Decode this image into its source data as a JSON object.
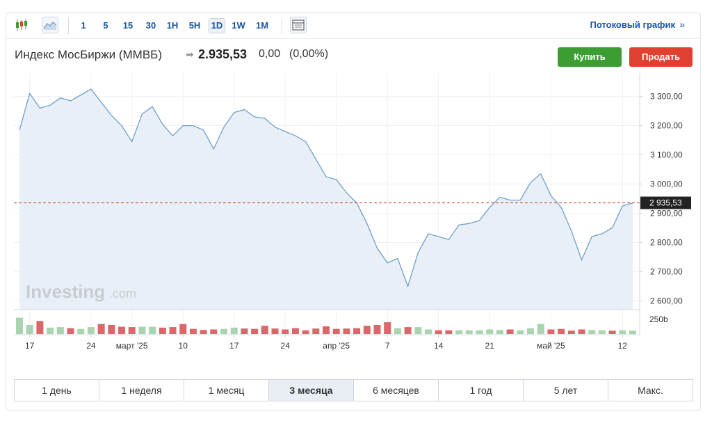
{
  "toolbar": {
    "candles_icon": "candlestick-icon",
    "area_icon": "area-chart-icon",
    "intervals": [
      "1",
      "5",
      "15",
      "30",
      "1H",
      "5H",
      "1D",
      "1W",
      "1M"
    ],
    "active_interval": "1D",
    "table_icon": "table-icon",
    "stream_label": "Потоковый график",
    "stream_arrow": "»"
  },
  "header": {
    "title": "Индекс МосБиржи (ММВБ)",
    "arrow": "➡",
    "price": "2.935,53",
    "change": "0,00",
    "change_pct": "(0,00%)",
    "buy_label": "Купить",
    "sell_label": "Продать"
  },
  "colors": {
    "line": "#6f9fc9",
    "fill": "#e9eff6",
    "vol_up": "#a9d4ad",
    "vol_down": "#d9686a",
    "last_price_line": "#c0392b",
    "accent": "#1a56a3"
  },
  "chart_data": {
    "type": "area",
    "y_ticks": [
      "3 300,00",
      "3 200,00",
      "3 100,00",
      "3 000,00",
      "2 900,00",
      "2 800,00",
      "2 700,00",
      "2 600,00"
    ],
    "y_tick_values": [
      3300,
      3200,
      3100,
      3000,
      2900,
      2800,
      2700,
      2600
    ],
    "ylim": [
      2570,
      3380
    ],
    "last_price_label": "2 935,53",
    "last_price": 2935.53,
    "volume_label": "250b",
    "x_ticks": [
      {
        "i": 1,
        "label": "17"
      },
      {
        "i": 7,
        "label": "24"
      },
      {
        "i": 11,
        "label": "март '25"
      },
      {
        "i": 16,
        "label": "10"
      },
      {
        "i": 21,
        "label": "17"
      },
      {
        "i": 26,
        "label": "24"
      },
      {
        "i": 31,
        "label": "апр '25"
      },
      {
        "i": 36,
        "label": "7"
      },
      {
        "i": 41,
        "label": "14"
      },
      {
        "i": 46,
        "label": "21"
      },
      {
        "i": 52,
        "label": "май '25"
      },
      {
        "i": 59,
        "label": "12"
      }
    ],
    "values": [
      3185,
      3310,
      3260,
      3270,
      3295,
      3285,
      3305,
      3325,
      3280,
      3235,
      3200,
      3145,
      3240,
      3265,
      3205,
      3165,
      3200,
      3200,
      3185,
      3120,
      3195,
      3245,
      3255,
      3230,
      3225,
      3195,
      3180,
      3165,
      3145,
      3085,
      3025,
      3015,
      2970,
      2935,
      2865,
      2780,
      2730,
      2745,
      2650,
      2765,
      2830,
      2820,
      2810,
      2860,
      2865,
      2875,
      2920,
      2955,
      2945,
      2945,
      3005,
      3035,
      2960,
      2920,
      2840,
      2740,
      2820,
      2830,
      2850,
      2925,
      2935
    ],
    "volume": [
      0.9,
      0.5,
      0.72,
      0.35,
      0.38,
      0.32,
      0.28,
      0.38,
      0.55,
      0.5,
      0.4,
      0.38,
      0.4,
      0.4,
      0.35,
      0.38,
      0.55,
      0.28,
      0.22,
      0.25,
      0.28,
      0.35,
      0.3,
      0.28,
      0.45,
      0.3,
      0.25,
      0.32,
      0.2,
      0.3,
      0.42,
      0.28,
      0.3,
      0.32,
      0.45,
      0.5,
      0.65,
      0.32,
      0.38,
      0.38,
      0.25,
      0.2,
      0.2,
      0.2,
      0.2,
      0.2,
      0.25,
      0.22,
      0.25,
      0.2,
      0.32,
      0.55,
      0.25,
      0.28,
      0.18,
      0.25,
      0.22,
      0.2,
      0.18,
      0.2,
      0.18
    ],
    "volume_up": [
      true,
      true,
      false,
      true,
      true,
      false,
      true,
      true,
      false,
      false,
      false,
      false,
      true,
      true,
      false,
      false,
      false,
      false,
      false,
      false,
      true,
      true,
      false,
      false,
      false,
      false,
      false,
      false,
      false,
      false,
      false,
      false,
      false,
      false,
      false,
      false,
      false,
      true,
      false,
      true,
      true,
      false,
      false,
      true,
      true,
      true,
      true,
      true,
      false,
      true,
      true,
      true,
      false,
      false,
      false,
      false,
      true,
      true,
      false,
      true,
      true
    ]
  },
  "ranges": [
    "1 день",
    "1 неделя",
    "1 месяц",
    "3 месяца",
    "6 месяцев",
    "1 год",
    "5 лет",
    "Макс."
  ],
  "active_range": "3 месяца"
}
